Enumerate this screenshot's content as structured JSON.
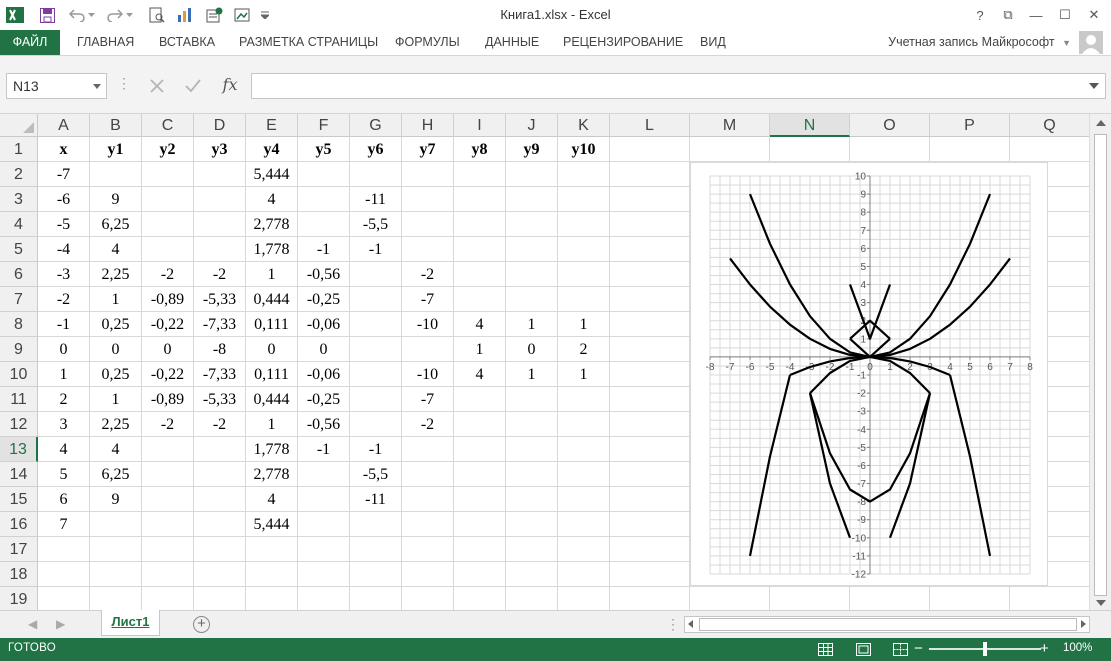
{
  "window": {
    "title": "Книга1.xlsx - Excel",
    "help": "?",
    "ribbon_display": "⧉",
    "minimize": "—",
    "maximize": "☐",
    "close": "✕"
  },
  "ribbon": {
    "tabs": [
      "ФАЙЛ",
      "ГЛАВНАЯ",
      "ВСТАВКА",
      "РАЗМЕТКА СТРАНИЦЫ",
      "ФОРМУЛЫ",
      "ДАННЫЕ",
      "РЕЦЕНЗИРОВАНИЕ",
      "ВИД"
    ],
    "account": "Учетная запись Майкрософт"
  },
  "formula_bar": {
    "name_box": "N13",
    "fx": "fx",
    "content": ""
  },
  "sheet": {
    "columns": [
      "A",
      "B",
      "C",
      "D",
      "E",
      "F",
      "G",
      "H",
      "I",
      "J",
      "K",
      "L",
      "M",
      "N",
      "O",
      "P",
      "Q"
    ],
    "active_column": "N",
    "active_row": "13",
    "rows": [
      "1",
      "2",
      "3",
      "4",
      "5",
      "6",
      "7",
      "8",
      "9",
      "10",
      "11",
      "12",
      "13",
      "14",
      "15",
      "16",
      "17",
      "18",
      "19"
    ],
    "cells": [
      [
        "x",
        "y1",
        "y2",
        "y3",
        "y4",
        "y5",
        "y6",
        "y7",
        "y8",
        "y9",
        "y10"
      ],
      [
        "-7",
        "",
        "",
        "",
        "5,444",
        "",
        "",
        "",
        "",
        "",
        ""
      ],
      [
        "-6",
        "9",
        "",
        "",
        "4",
        "",
        "-11",
        "",
        "",
        "",
        ""
      ],
      [
        "-5",
        "6,25",
        "",
        "",
        "2,778",
        "",
        "-5,5",
        "",
        "",
        "",
        ""
      ],
      [
        "-4",
        "4",
        "",
        "",
        "1,778",
        "-1",
        "-1",
        "",
        "",
        "",
        ""
      ],
      [
        "-3",
        "2,25",
        "-2",
        "-2",
        "1",
        "-0,56",
        "",
        "-2",
        "",
        "",
        ""
      ],
      [
        "-2",
        "1",
        "-0,89",
        "-5,33",
        "0,444",
        "-0,25",
        "",
        "-7",
        "",
        "",
        ""
      ],
      [
        "-1",
        "0,25",
        "-0,22",
        "-7,33",
        "0,111",
        "-0,06",
        "",
        "-10",
        "4",
        "1",
        "1"
      ],
      [
        "0",
        "0",
        "0",
        "-8",
        "0",
        "0",
        "",
        "",
        "1",
        "0",
        "2"
      ],
      [
        "1",
        "0,25",
        "-0,22",
        "-7,33",
        "0,111",
        "-0,06",
        "",
        "-10",
        "4",
        "1",
        "1"
      ],
      [
        "2",
        "1",
        "-0,89",
        "-5,33",
        "0,444",
        "-0,25",
        "",
        "-7",
        "",
        "",
        ""
      ],
      [
        "3",
        "2,25",
        "-2",
        "-2",
        "1",
        "-0,56",
        "",
        "-2",
        "",
        "",
        ""
      ],
      [
        "4",
        "4",
        "",
        "",
        "1,778",
        "-1",
        "-1",
        "",
        "",
        "",
        ""
      ],
      [
        "5",
        "6,25",
        "",
        "",
        "2,778",
        "",
        "-5,5",
        "",
        "",
        "",
        ""
      ],
      [
        "6",
        "9",
        "",
        "",
        "4",
        "",
        "-11",
        "",
        "",
        "",
        ""
      ],
      [
        "7",
        "",
        "",
        "",
        "5,444",
        "",
        "",
        "",
        "",
        "",
        ""
      ]
    ],
    "tab_name": "Лист1",
    "add_sheet": "⊕"
  },
  "chart_data": {
    "type": "line",
    "title": "",
    "xlabel": "",
    "ylabel": "",
    "xlim": [
      -8,
      8
    ],
    "ylim": [
      -12,
      10
    ],
    "x_ticks": [
      "-8",
      "-7",
      "-6",
      "-5",
      "-4",
      "-3",
      "-2",
      "-1",
      "0",
      "1",
      "2",
      "3",
      "4",
      "5",
      "6",
      "7",
      "8"
    ],
    "y_ticks": [
      "10",
      "9",
      "8",
      "7",
      "6",
      "5",
      "4",
      "3",
      "2",
      "1",
      "0",
      "-1",
      "-2",
      "-3",
      "-4",
      "-5",
      "-6",
      "-7",
      "-8",
      "-9",
      "-10",
      "-11",
      "-12"
    ],
    "grid": true,
    "line_color": "#000000",
    "series": [
      {
        "x": [
          -6,
          -5,
          -4,
          -3,
          -2,
          -1,
          0,
          1,
          2,
          3,
          4,
          5,
          6
        ],
        "y": [
          9,
          6.25,
          4,
          2.25,
          1,
          0.25,
          0,
          0.25,
          1,
          2.25,
          4,
          6.25,
          9
        ]
      },
      {
        "x": [
          -3,
          -2,
          -1,
          0,
          1,
          2,
          3
        ],
        "y": [
          -2,
          -0.89,
          -0.22,
          0,
          -0.22,
          -0.89,
          -2
        ]
      },
      {
        "x": [
          -3,
          -2,
          -1,
          0,
          1,
          2,
          3
        ],
        "y": [
          -2,
          -5.33,
          -7.33,
          -8,
          -7.33,
          -5.33,
          -2
        ]
      },
      {
        "x": [
          -7,
          -6,
          -5,
          -4,
          -3,
          -2,
          -1,
          0,
          1,
          2,
          3,
          4,
          5,
          6,
          7
        ],
        "y": [
          5.444,
          4,
          2.778,
          1.778,
          1,
          0.444,
          0.111,
          0,
          0.111,
          0.444,
          1,
          1.778,
          2.778,
          4,
          5.444
        ]
      },
      {
        "x": [
          -4,
          -3,
          -2,
          -1,
          0,
          1,
          2,
          3,
          4
        ],
        "y": [
          -1,
          -0.56,
          -0.25,
          -0.06,
          0,
          -0.06,
          -0.25,
          -0.56,
          -1
        ]
      },
      {
        "x": [
          -6,
          -5,
          -4
        ],
        "y": [
          -11,
          -5.5,
          -1
        ]
      },
      {
        "x": [
          4,
          5,
          6
        ],
        "y": [
          -1,
          -5.5,
          -11
        ]
      },
      {
        "x": [
          -3,
          -2,
          -1
        ],
        "y": [
          -2,
          -7,
          -10
        ]
      },
      {
        "x": [
          1,
          2,
          3
        ],
        "y": [
          -10,
          -7,
          -2
        ]
      },
      {
        "x": [
          -1,
          0,
          1
        ],
        "y": [
          4,
          1,
          4
        ]
      },
      {
        "x": [
          -1,
          0,
          1
        ],
        "y": [
          1,
          0,
          1
        ]
      },
      {
        "x": [
          -1,
          0,
          1
        ],
        "y": [
          1,
          2,
          1
        ]
      }
    ]
  },
  "status": {
    "text": "ГОТОВО",
    "zoom": "100%",
    "zoom_minus": "−",
    "zoom_plus": "+"
  }
}
